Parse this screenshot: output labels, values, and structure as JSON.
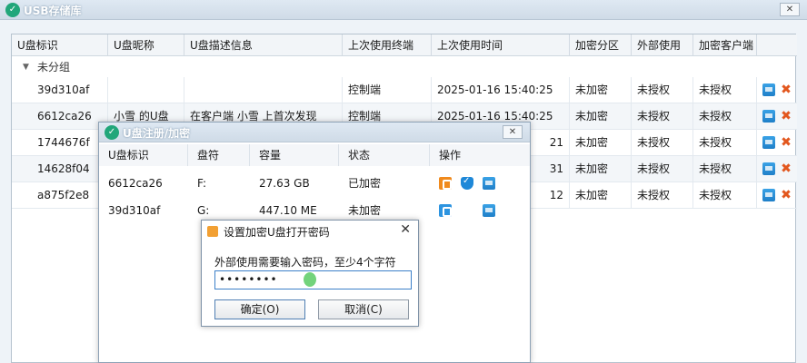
{
  "main": {
    "title": "USB存储库",
    "columns": [
      "U盘标识",
      "U盘昵称",
      "U盘描述信息",
      "上次使用终端",
      "上次使用时间",
      "加密分区",
      "外部使用",
      "加密客户端"
    ],
    "group_label": "未分组",
    "rows": [
      {
        "id": "39d310af",
        "nick": "",
        "desc": "",
        "terminal": "控制端",
        "time": "2025-01-16 15:40:25",
        "enc": "未加密",
        "ext": "未授权",
        "client": "未授权"
      },
      {
        "id": "6612ca26",
        "nick": "小雪 的U盘",
        "desc": "在客户端 小雪 上首次发现",
        "terminal": "控制端",
        "time": "2025-01-16 15:40:25",
        "enc": "未加密",
        "ext": "未授权",
        "client": "未授权"
      },
      {
        "id": "1744676f",
        "nick": "",
        "desc": "",
        "terminal": "",
        "time": "21",
        "enc": "未加密",
        "ext": "未授权",
        "client": "未授权"
      },
      {
        "id": "14628f04",
        "nick": "",
        "desc": "",
        "terminal": "",
        "time": "31",
        "enc": "未加密",
        "ext": "未授权",
        "client": "未授权"
      },
      {
        "id": "a875f2e8",
        "nick": "",
        "desc": "",
        "terminal": "",
        "time": "12",
        "enc": "未加密",
        "ext": "未授权",
        "client": "未授权"
      }
    ]
  },
  "register_dialog": {
    "title": "U盘注册/加密",
    "columns": [
      "U盘标识",
      "盘符",
      "容量",
      "状态",
      "操作"
    ],
    "rows": [
      {
        "id": "6612ca26",
        "drive": "F:",
        "size": "27.63 GB",
        "status": "已加密"
      },
      {
        "id": "39d310af",
        "drive": "G:",
        "size": "447.10 ME",
        "status": "未加密"
      }
    ]
  },
  "password_dialog": {
    "title": "设置加密U盘打开密码",
    "prompt": "外部使用需要输入密码，至少4个字符",
    "value": "••••••••",
    "ok_label": "确定(O)",
    "cancel_label": "取消(C)"
  }
}
